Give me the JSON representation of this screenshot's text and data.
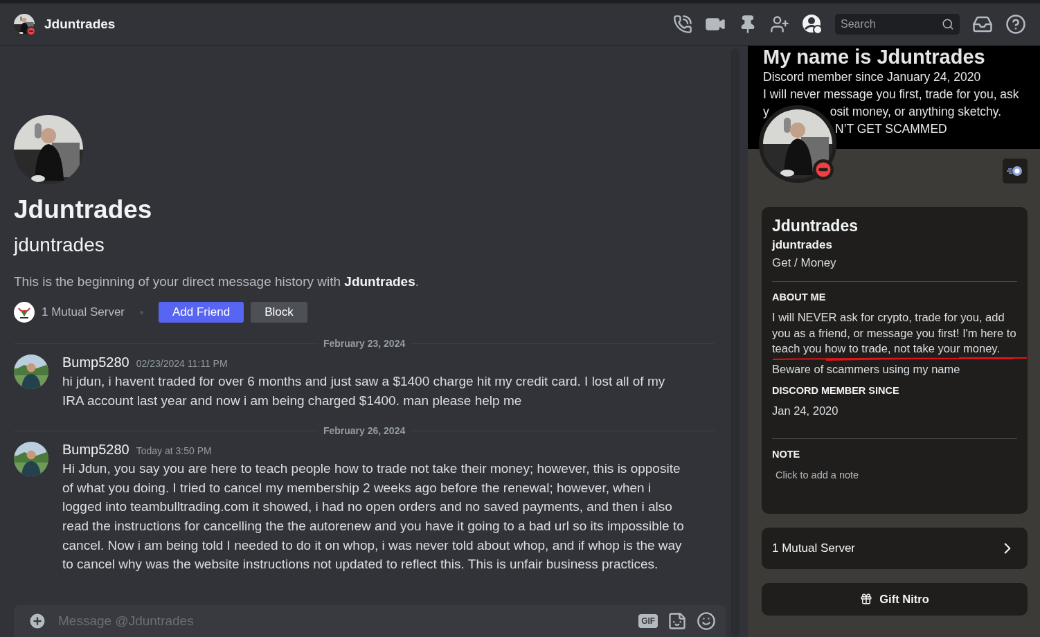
{
  "header": {
    "title": "Jduntrades",
    "search": {
      "placeholder": "Search"
    }
  },
  "intro": {
    "display_name": "Jduntrades",
    "username": "jduntrades",
    "text": "This is the beginning of your direct message history with **Jduntrades**.",
    "mutual_servers": "1 Mutual Server",
    "buttons": [
      {
        "label": "Add Friend",
        "kind": "primary"
      },
      {
        "label": "Block",
        "kind": "secondary"
      }
    ]
  },
  "messages": [
    {
      "date_divider": "February 23, 2024",
      "author": "Bump5280",
      "time": "02/23/2024 11:11 PM",
      "text": "hi jdun, i havent traded for over 6 months and just saw a $1400 charge hit my credit card. I lost all of my IRA account last year and now i am being charged $1400. man please help me"
    },
    {
      "date_divider": "February 26, 2024",
      "author": "Bump5280",
      "time": "Today at 3:50 PM",
      "text": "Hi Jdun, you say you are here to teach people how to trade not take their money; however, this is opposite of what you doing. I tried to cancel my membership 2 weeks ago before the renewal; however, when i logged into teambulltrading.com it showed, i had no open orders and no saved payments, and then i also read the instructions for cancelling the the autorenew and you have it going to a bad url so its impossible to cancel. Now i am being told I needed to do it on whop, i was never told about whop, and if whop is the way to cancel why was the website instructions not updated to reflect this. This is unfair business practices."
    }
  ],
  "composer": {
    "placeholder": "Message @Jduntrades",
    "gif_label": "GIF"
  },
  "profile": {
    "banner": {
      "title": "My name is Jduntrades",
      "lines": [
        {
          "parts": [
            "Discord member since January 24, 2020"
          ],
          "lead_hidden": false
        },
        {
          "parts": [
            "I will never message you first, trade for you, ask"
          ],
          "lead_hidden": false
        },
        {
          "parts": [
            "y",
            "osit money, or anything sketchy."
          ],
          "lead_hidden": false
        },
        {
          "parts": [
            "N’T GET SCAMMED"
          ],
          "lead_hidden": true
        }
      ]
    },
    "display_name": "Jduntrades",
    "username": "jduntrades",
    "pronouns": "Get / Money",
    "sections": [
      {
        "kind": "text",
        "heading": "ABOUT ME",
        "paragraphs": [
          "I will NEVER ask for crypto, trade for you, add you as a friend, or message you first! I'm here to teach you how to trade, not take your money.",
          "Beware of scammers using my name"
        ]
      },
      {
        "kind": "text",
        "heading": "DISCORD MEMBER SINCE",
        "paragraphs": [
          "Jan 24, 2020"
        ]
      },
      {
        "kind": "note",
        "heading": "NOTE",
        "placeholder": "Click to add a note"
      }
    ],
    "mutual_servers": "1 Mutual Server",
    "gift_button": "Gift Nitro"
  }
}
